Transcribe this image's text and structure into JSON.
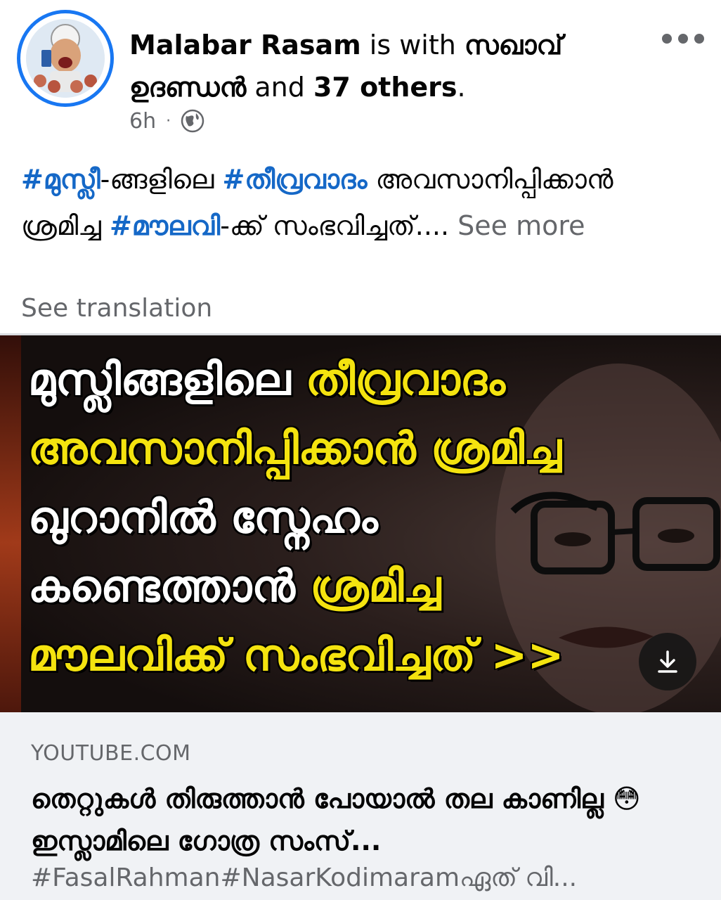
{
  "post": {
    "author": "Malabar Rasam",
    "is_with_text": " is with ",
    "tagged_user": "സഖാവ് ഉദണ്ഡൻ",
    "and_text": " and ",
    "others": "37 others",
    "period": ".",
    "time": "6h",
    "dot": "·",
    "privacy_icon": "globe-icon",
    "menu_icon": "more-horizontal-icon"
  },
  "body": {
    "tag1": "#മുസ്ലീ",
    "text1": "-ങ്ങളിലെ ",
    "tag2": "#തീവ്രവാദം",
    "text2": " അവസാനിപ്പിക്കാൻ ശ്രമിച്ച ",
    "tag3": "#മൗലവി",
    "text3": "-ക്ക് സംഭവിച്ചത്.... ",
    "see_more": "See more"
  },
  "see_translation": "See translation",
  "thumbnail": {
    "line1_white": "മുസ്ലിങ്ങളിലെ ",
    "line1_yellow": "തീവ്രവാദം",
    "line2_yellow": "അവസാനിപ്പിക്കാൻ ശ്രമിച്ച",
    "line3_white": "ഖുറാനിൽ സ്നേഹം",
    "line4_white": "കണ്ടെത്താൻ ",
    "line4_yellow": "ശ്രമിച്ച",
    "line5_yellow": "മൗലവിക്ക് സംഭവിച്ചത് >>",
    "download_icon": "download-icon",
    "colors": {
      "highlight": "#f4e30f",
      "text": "#ffffff"
    }
  },
  "link": {
    "domain": "YOUTUBE.COM",
    "title": "തെറ്റുകൾ തിരുത്താൻ പോയാൽ തല കാണില്ല 😳 ഇസ്ലാമിലെ ഗോത്ര സംസ്...",
    "description": "#FasalRahman#NasarKodimaramഏത് വി..."
  },
  "colors": {
    "accent": "#1877f2",
    "hashtag": "#1568c7",
    "muted": "#65676b"
  }
}
